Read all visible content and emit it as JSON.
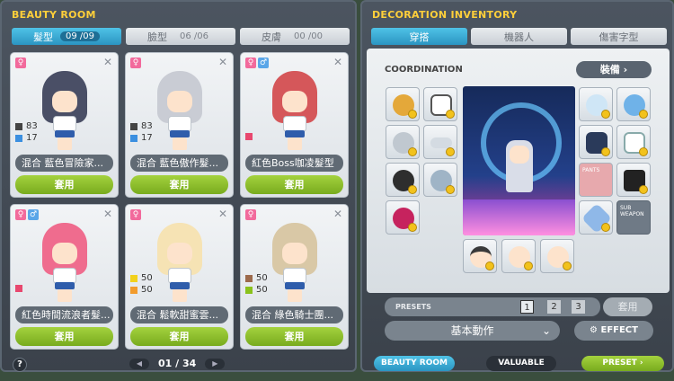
{
  "left": {
    "title": "BEAUTY ROOM",
    "tabs": [
      {
        "label": "髮型",
        "count": "09 /09"
      },
      {
        "label": "臉型",
        "count": "06 /06"
      },
      {
        "label": "皮膚",
        "count": "00 /00"
      }
    ],
    "cards": [
      {
        "gender": "♀",
        "c1": "83",
        "c2": "17",
        "name": "混合 藍色冒險家...",
        "apply": "套用"
      },
      {
        "gender": "♀",
        "c1": "83",
        "c2": "17",
        "name": "混合 藍色傲作髮...",
        "apply": "套用"
      },
      {
        "gender": "♀",
        "gender2": "♂",
        "name": "紅色Boss咖凌髮型",
        "apply": "套用"
      },
      {
        "gender": "♀",
        "gender2": "♂",
        "name": "紅色時間流浪者髮...",
        "apply": "套用"
      },
      {
        "gender": "♀",
        "c1": "50",
        "c2": "50",
        "name": "混合 鬆軟甜蜜雲...",
        "apply": "套用"
      },
      {
        "gender": "♀",
        "c1": "50",
        "c2": "50",
        "name": "混合 綠色騎士團...",
        "apply": "套用"
      }
    ],
    "page": "01 / 34",
    "help": "?"
  },
  "right": {
    "title": "DECORATION INVENTORY",
    "tabs": [
      "穿搭",
      "機器人",
      "傷害字型"
    ],
    "coordination": "COORDINATION",
    "equip_button": "裝備",
    "slot_labels": {
      "pants": "PANTS",
      "subweapon": "SUB\nWEAPON"
    },
    "presets_label": "PRESETS",
    "preset_numbers": [
      "1",
      "2",
      "3"
    ],
    "preset_apply": "套用",
    "motion_select": "基本動作",
    "effect_button": "EFFECT"
  },
  "bottom": {
    "beauty_room": "BEAUTY ROOM",
    "valuable": "VALUABLE",
    "preset": "PRESET"
  },
  "colors": {
    "title_yellow": "#ffcf3a",
    "tab_blue": "#2b95c2",
    "apply_green": "#78ab1e"
  }
}
